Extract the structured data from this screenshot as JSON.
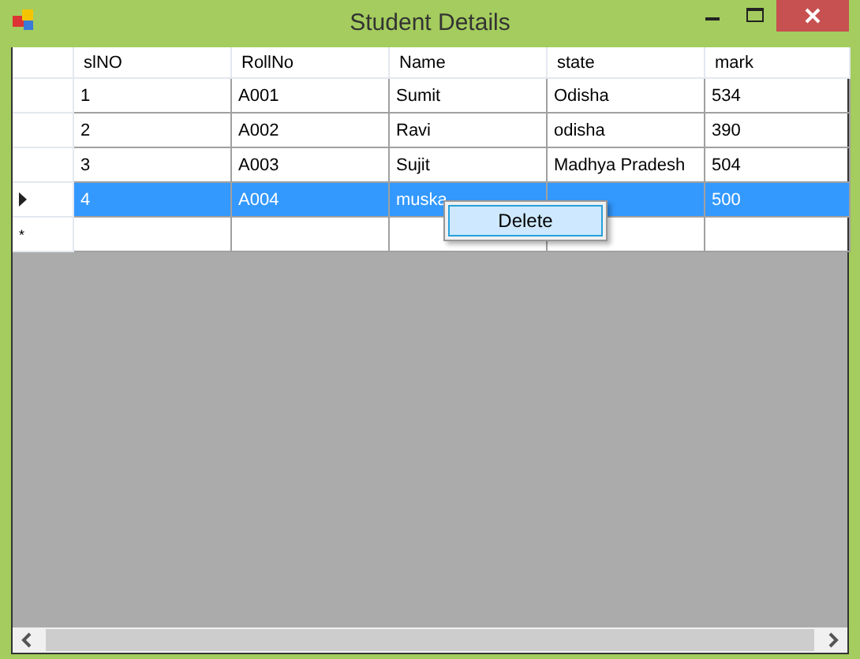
{
  "window": {
    "title": "Student Details"
  },
  "table": {
    "columns": [
      "slNO",
      "RollNo",
      "Name",
      "state",
      "mark"
    ],
    "rows": [
      {
        "selected": false,
        "cells": [
          "1",
          "A001",
          "Sumit",
          "Odisha",
          "534"
        ]
      },
      {
        "selected": false,
        "cells": [
          "2",
          "A002",
          "Ravi",
          "odisha",
          "390"
        ]
      },
      {
        "selected": false,
        "cells": [
          "3",
          "A003",
          "Sujit",
          "Madhya Pradesh",
          "504"
        ]
      },
      {
        "selected": true,
        "cells": [
          "4",
          "A004",
          "muska",
          "",
          "500"
        ]
      }
    ],
    "new_row_marker": "*"
  },
  "context_menu": {
    "items": [
      {
        "label": "Delete",
        "selected": true
      }
    ]
  }
}
